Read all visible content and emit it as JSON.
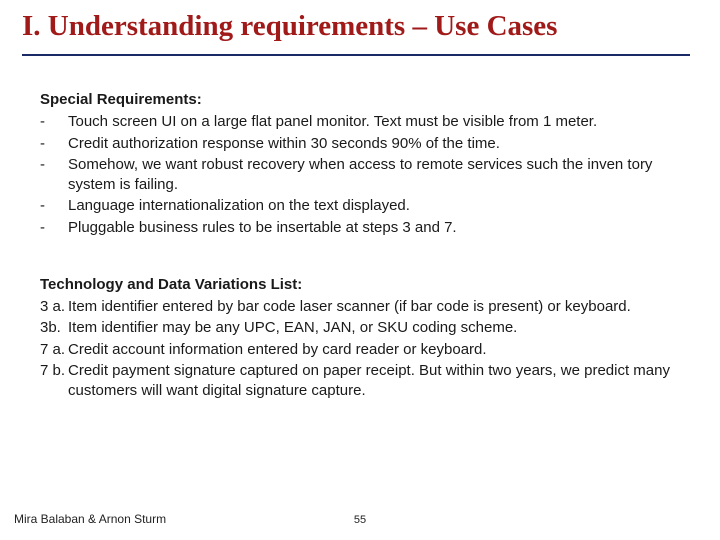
{
  "title": "I. Understanding requirements – Use Cases",
  "special": {
    "heading": "Special Requirements:",
    "items": [
      "Touch screen UI on a large flat panel monitor. Text must be visible from 1 meter.",
      "Credit authorization response within 30 seconds 90% of the time.",
      "Somehow, we want robust recovery when access to remote services such the inven tory system is failing.",
      "Language internationalization on the text displayed.",
      "Pluggable business rules to be insertable at steps 3 and 7."
    ]
  },
  "tech": {
    "heading": "Technology and Data Variations List:",
    "entries": [
      {
        "marker": "3 a.",
        "text": "Item identifier entered by bar code laser scanner (if bar code is present) or keyboard."
      },
      {
        "marker": "3b.",
        "text": "Item identifier may be any UPC, EAN, JAN, or SKU coding scheme."
      },
      {
        "marker": "7 a.",
        "text": "Credit account information entered by card reader or keyboard."
      },
      {
        "marker": "7 b.",
        "text": "Credit payment signature captured on paper receipt. But within two years, we predict many customers will want digital signature capture."
      }
    ]
  },
  "footer": {
    "author": "Mira Balaban  &  Arnon Sturm",
    "page": "55"
  }
}
